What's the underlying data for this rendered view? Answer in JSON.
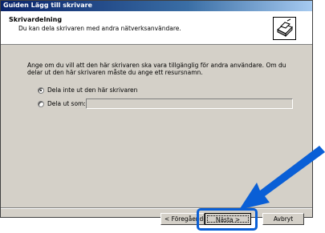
{
  "window": {
    "title": "Guiden Lägg till skrivare"
  },
  "header": {
    "title": "Skrivardelning",
    "subtitle": "Du kan dela skrivaren med andra nätverksanvändare."
  },
  "body": {
    "description": "Ange om du vill att den här skrivaren ska vara tillgänglig för andra användare. Om du delar ut den här skrivaren måste du ange ett resursnamn.",
    "option_no_share": "Dela inte ut den här skrivaren",
    "option_share_as": "Dela ut som:",
    "share_name_value": "",
    "selected_option": "no_share"
  },
  "buttons": {
    "back": "< Föregående",
    "next": "Nästa >",
    "cancel": "Avbryt"
  },
  "colors": {
    "callout_blue": "#0a5fd6",
    "dialog_gray": "#d4d0c8",
    "title_blue": "#0a246a"
  },
  "icons": {
    "printer": "printer-icon",
    "arrow": "pointer-arrow-icon"
  }
}
